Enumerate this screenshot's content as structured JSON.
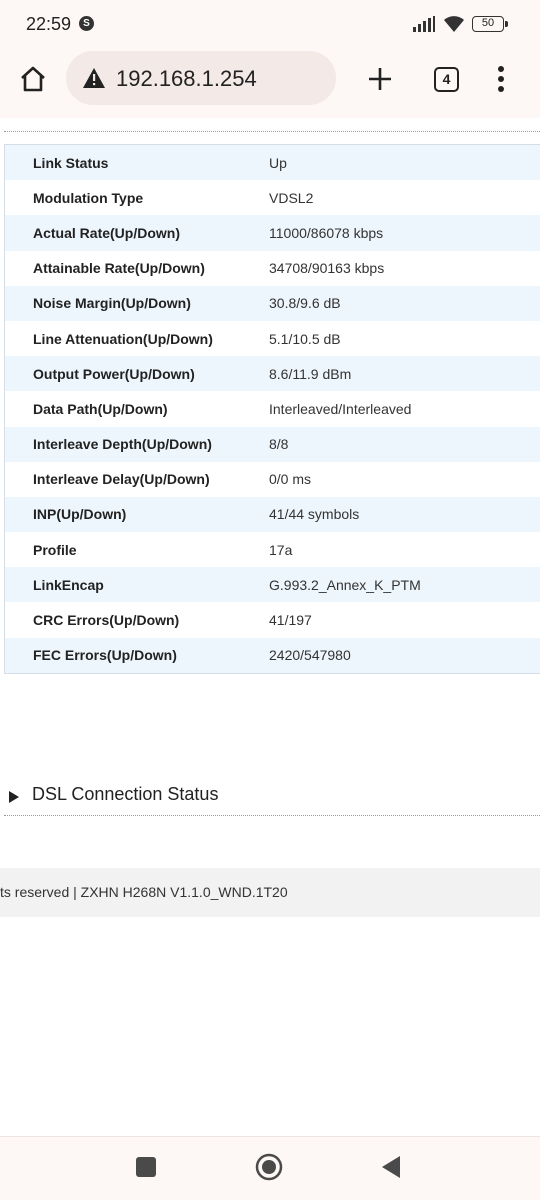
{
  "status_bar": {
    "time": "22:59",
    "carrier_badge": "S",
    "battery": "50",
    "icons": [
      "signal-icon",
      "wifi-icon",
      "battery-icon"
    ]
  },
  "browser": {
    "url": "192.168.1.254",
    "tab_count": "4",
    "icons": [
      "home-icon",
      "warning-icon",
      "plus-icon",
      "menu-icon"
    ]
  },
  "dsl_table": {
    "rows": [
      {
        "label": "Link Status",
        "value": "Up"
      },
      {
        "label": "Modulation Type",
        "value": "VDSL2"
      },
      {
        "label": "Actual Rate(Up/Down)",
        "value": "11000/86078 kbps"
      },
      {
        "label": "Attainable Rate(Up/Down)",
        "value": "34708/90163 kbps"
      },
      {
        "label": "Noise Margin(Up/Down)",
        "value": "30.8/9.6 dB"
      },
      {
        "label": "Line Attenuation(Up/Down)",
        "value": "5.1/10.5 dB"
      },
      {
        "label": "Output Power(Up/Down)",
        "value": "8.6/11.9 dBm"
      },
      {
        "label": "Data Path(Up/Down)",
        "value": "Interleaved/Interleaved"
      },
      {
        "label": "Interleave Depth(Up/Down)",
        "value": "8/8"
      },
      {
        "label": "Interleave Delay(Up/Down)",
        "value": "0/0 ms"
      },
      {
        "label": "INP(Up/Down)",
        "value": "41/44 symbols"
      },
      {
        "label": "Profile",
        "value": "17a"
      },
      {
        "label": "LinkEncap",
        "value": "G.993.2_Annex_K_PTM"
      },
      {
        "label": "CRC Errors(Up/Down)",
        "value": "41/197"
      },
      {
        "label": "FEC Errors(Up/Down)",
        "value": "2420/547980"
      }
    ]
  },
  "section": {
    "title": "DSL Connection Status"
  },
  "footer": {
    "text": "ts reserved  |   ZXHN H268N V1.1.0_WND.1T20"
  },
  "colors": {
    "row_stripe": "#eef6fd",
    "chrome_bg": "#fdf7f6",
    "url_bar_bg": "#f3e9e7"
  }
}
